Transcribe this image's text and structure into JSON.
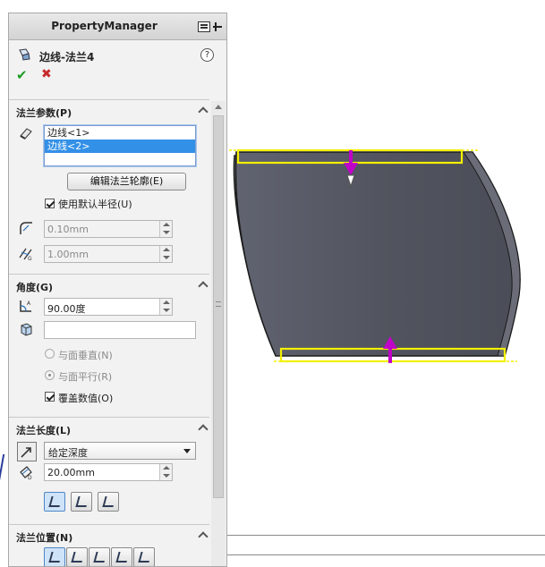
{
  "header": {
    "title": "PropertyManager"
  },
  "feature": {
    "title": "边线-法兰4",
    "help": "?"
  },
  "actions": {
    "ok": "✔",
    "cancel": "✖"
  },
  "flange_params": {
    "title": "法兰参数(P)",
    "edges": [
      "边线<1>",
      "边线<2>"
    ],
    "selected_index": 1,
    "edit_profile_label": "编辑法兰轮廓(E)",
    "use_default_radius_label": "使用默认半径(U)",
    "use_default_radius_checked": true,
    "radius_value": "0.10mm",
    "gap_value": "1.00mm"
  },
  "angle": {
    "title": "角度(G)",
    "angle_value": "90.00度",
    "reference_value": "",
    "perpendicular_label": "与面垂直(N)",
    "parallel_label": "与面平行(R)",
    "parallel_selected": true,
    "override_label": "覆盖数值(O)",
    "override_checked": true
  },
  "flange_length": {
    "title": "法兰长度(L)",
    "end_condition": "给定深度",
    "length_value": "20.00mm"
  },
  "flange_position": {
    "title": "法兰位置(N)"
  },
  "colors": {
    "panel_bg": "#f2f2f2",
    "selection_blue": "#3390e7",
    "model_fill": "#52555f",
    "highlight_yellow": "#f4f000",
    "arrow_magenta": "#c000c8",
    "ok_green": "#1e9c22",
    "cancel_red": "#c82a2a"
  }
}
